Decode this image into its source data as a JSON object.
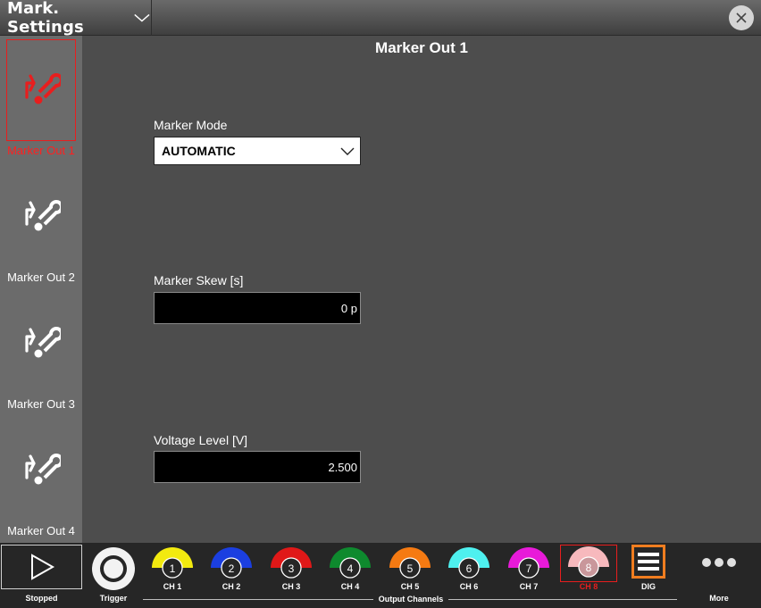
{
  "title_bar": {
    "title": "Mark. Settings",
    "close_icon": "close-icon"
  },
  "sidebar": {
    "items": [
      {
        "label": "Marker Out 1",
        "icon": "marker-wrench-icon",
        "active": true
      },
      {
        "label": "Marker Out 2",
        "icon": "marker-wrench-icon",
        "active": false
      },
      {
        "label": "Marker Out 3",
        "icon": "marker-wrench-icon",
        "active": false
      },
      {
        "label": "Marker Out 4",
        "icon": "marker-wrench-icon",
        "active": false
      }
    ]
  },
  "main": {
    "title": "Marker Out 1",
    "marker_mode": {
      "label": "Marker Mode",
      "value": "AUTOMATIC"
    },
    "marker_skew": {
      "label": "Marker Skew [s]",
      "value": "0 p"
    },
    "voltage_level": {
      "label": "Voltage Level [V]",
      "value": "2.500"
    }
  },
  "bottom_bar": {
    "stopped_label": "Stopped",
    "trigger_label": "Trigger",
    "group_label": "Output Channels",
    "dig_label": "DIG",
    "more_label": "More",
    "channels": [
      {
        "number": "1",
        "label": "CH 1",
        "color": "#f2ea0f"
      },
      {
        "number": "2",
        "label": "CH 2",
        "color": "#1b3fe0"
      },
      {
        "number": "3",
        "label": "CH 3",
        "color": "#e01818"
      },
      {
        "number": "4",
        "label": "CH 4",
        "color": "#0e8a2e"
      },
      {
        "number": "5",
        "label": "CH 5",
        "color": "#f57a12"
      },
      {
        "number": "6",
        "label": "CH 6",
        "color": "#4ef0ef"
      },
      {
        "number": "7",
        "label": "CH 7",
        "color": "#e81ad9"
      },
      {
        "number": "8",
        "label": "CH 8",
        "color": "#f7b9bd"
      }
    ]
  },
  "colors": {
    "accent_active": "#e81e1e",
    "dig_accent": "#f07d1f"
  }
}
